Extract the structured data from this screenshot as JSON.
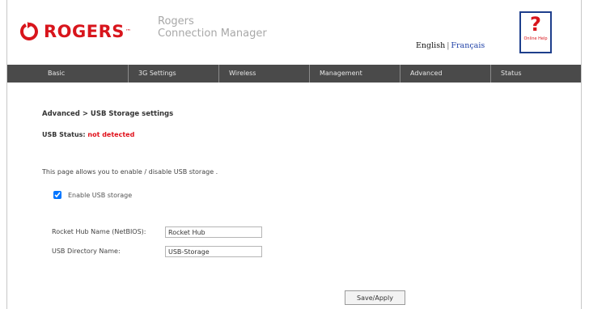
{
  "header": {
    "brand": "ROGERS",
    "product_line1": "Rogers",
    "product_line2": "Connection Manager",
    "lang_english": "English",
    "lang_separator": "|",
    "lang_french": "Français",
    "help_symbol": "?",
    "help_text": "Online Help",
    "brand_color": "#d8151c",
    "help_icon": "question-mark-icon"
  },
  "nav": {
    "items": [
      "Basic",
      "3G Settings",
      "Wireless",
      "Management",
      "Advanced",
      "Status"
    ]
  },
  "page": {
    "breadcrumb": "Advanced > USB Storage settings",
    "status_label": "USB Status:",
    "status_value": "not detected",
    "description": "This page allows you to enable / disable USB storage .",
    "enable_label": "Enable USB storage",
    "enable_checked": true,
    "hub_name_label": "Rocket Hub Name (NetBIOS):",
    "hub_name_value": "Rocket Hub",
    "directory_label": "USB Directory Name:",
    "directory_value": "USB-Storage",
    "save_label": "Save/Apply"
  }
}
